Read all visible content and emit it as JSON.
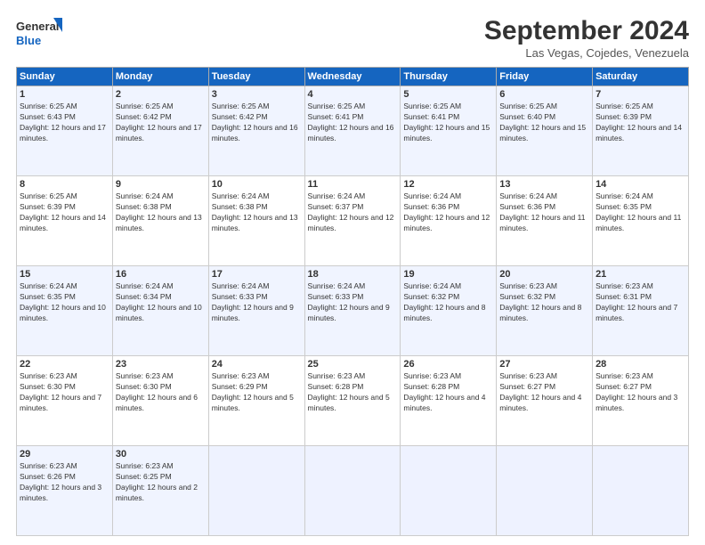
{
  "logo": {
    "general": "General",
    "blue": "Blue"
  },
  "title": "September 2024",
  "location": "Las Vegas, Cojedes, Venezuela",
  "columns": [
    "Sunday",
    "Monday",
    "Tuesday",
    "Wednesday",
    "Thursday",
    "Friday",
    "Saturday"
  ],
  "weeks": [
    [
      {
        "day": "1",
        "sunrise": "6:25 AM",
        "sunset": "6:43 PM",
        "daylight": "12 hours and 17 minutes."
      },
      {
        "day": "2",
        "sunrise": "6:25 AM",
        "sunset": "6:42 PM",
        "daylight": "12 hours and 17 minutes."
      },
      {
        "day": "3",
        "sunrise": "6:25 AM",
        "sunset": "6:42 PM",
        "daylight": "12 hours and 16 minutes."
      },
      {
        "day": "4",
        "sunrise": "6:25 AM",
        "sunset": "6:41 PM",
        "daylight": "12 hours and 16 minutes."
      },
      {
        "day": "5",
        "sunrise": "6:25 AM",
        "sunset": "6:41 PM",
        "daylight": "12 hours and 15 minutes."
      },
      {
        "day": "6",
        "sunrise": "6:25 AM",
        "sunset": "6:40 PM",
        "daylight": "12 hours and 15 minutes."
      },
      {
        "day": "7",
        "sunrise": "6:25 AM",
        "sunset": "6:39 PM",
        "daylight": "12 hours and 14 minutes."
      }
    ],
    [
      {
        "day": "8",
        "sunrise": "6:25 AM",
        "sunset": "6:39 PM",
        "daylight": "12 hours and 14 minutes."
      },
      {
        "day": "9",
        "sunrise": "6:24 AM",
        "sunset": "6:38 PM",
        "daylight": "12 hours and 13 minutes."
      },
      {
        "day": "10",
        "sunrise": "6:24 AM",
        "sunset": "6:38 PM",
        "daylight": "12 hours and 13 minutes."
      },
      {
        "day": "11",
        "sunrise": "6:24 AM",
        "sunset": "6:37 PM",
        "daylight": "12 hours and 12 minutes."
      },
      {
        "day": "12",
        "sunrise": "6:24 AM",
        "sunset": "6:36 PM",
        "daylight": "12 hours and 12 minutes."
      },
      {
        "day": "13",
        "sunrise": "6:24 AM",
        "sunset": "6:36 PM",
        "daylight": "12 hours and 11 minutes."
      },
      {
        "day": "14",
        "sunrise": "6:24 AM",
        "sunset": "6:35 PM",
        "daylight": "12 hours and 11 minutes."
      }
    ],
    [
      {
        "day": "15",
        "sunrise": "6:24 AM",
        "sunset": "6:35 PM",
        "daylight": "12 hours and 10 minutes."
      },
      {
        "day": "16",
        "sunrise": "6:24 AM",
        "sunset": "6:34 PM",
        "daylight": "12 hours and 10 minutes."
      },
      {
        "day": "17",
        "sunrise": "6:24 AM",
        "sunset": "6:33 PM",
        "daylight": "12 hours and 9 minutes."
      },
      {
        "day": "18",
        "sunrise": "6:24 AM",
        "sunset": "6:33 PM",
        "daylight": "12 hours and 9 minutes."
      },
      {
        "day": "19",
        "sunrise": "6:24 AM",
        "sunset": "6:32 PM",
        "daylight": "12 hours and 8 minutes."
      },
      {
        "day": "20",
        "sunrise": "6:23 AM",
        "sunset": "6:32 PM",
        "daylight": "12 hours and 8 minutes."
      },
      {
        "day": "21",
        "sunrise": "6:23 AM",
        "sunset": "6:31 PM",
        "daylight": "12 hours and 7 minutes."
      }
    ],
    [
      {
        "day": "22",
        "sunrise": "6:23 AM",
        "sunset": "6:30 PM",
        "daylight": "12 hours and 7 minutes."
      },
      {
        "day": "23",
        "sunrise": "6:23 AM",
        "sunset": "6:30 PM",
        "daylight": "12 hours and 6 minutes."
      },
      {
        "day": "24",
        "sunrise": "6:23 AM",
        "sunset": "6:29 PM",
        "daylight": "12 hours and 5 minutes."
      },
      {
        "day": "25",
        "sunrise": "6:23 AM",
        "sunset": "6:28 PM",
        "daylight": "12 hours and 5 minutes."
      },
      {
        "day": "26",
        "sunrise": "6:23 AM",
        "sunset": "6:28 PM",
        "daylight": "12 hours and 4 minutes."
      },
      {
        "day": "27",
        "sunrise": "6:23 AM",
        "sunset": "6:27 PM",
        "daylight": "12 hours and 4 minutes."
      },
      {
        "day": "28",
        "sunrise": "6:23 AM",
        "sunset": "6:27 PM",
        "daylight": "12 hours and 3 minutes."
      }
    ],
    [
      {
        "day": "29",
        "sunrise": "6:23 AM",
        "sunset": "6:26 PM",
        "daylight": "12 hours and 3 minutes."
      },
      {
        "day": "30",
        "sunrise": "6:23 AM",
        "sunset": "6:25 PM",
        "daylight": "12 hours and 2 minutes."
      },
      null,
      null,
      null,
      null,
      null
    ]
  ]
}
